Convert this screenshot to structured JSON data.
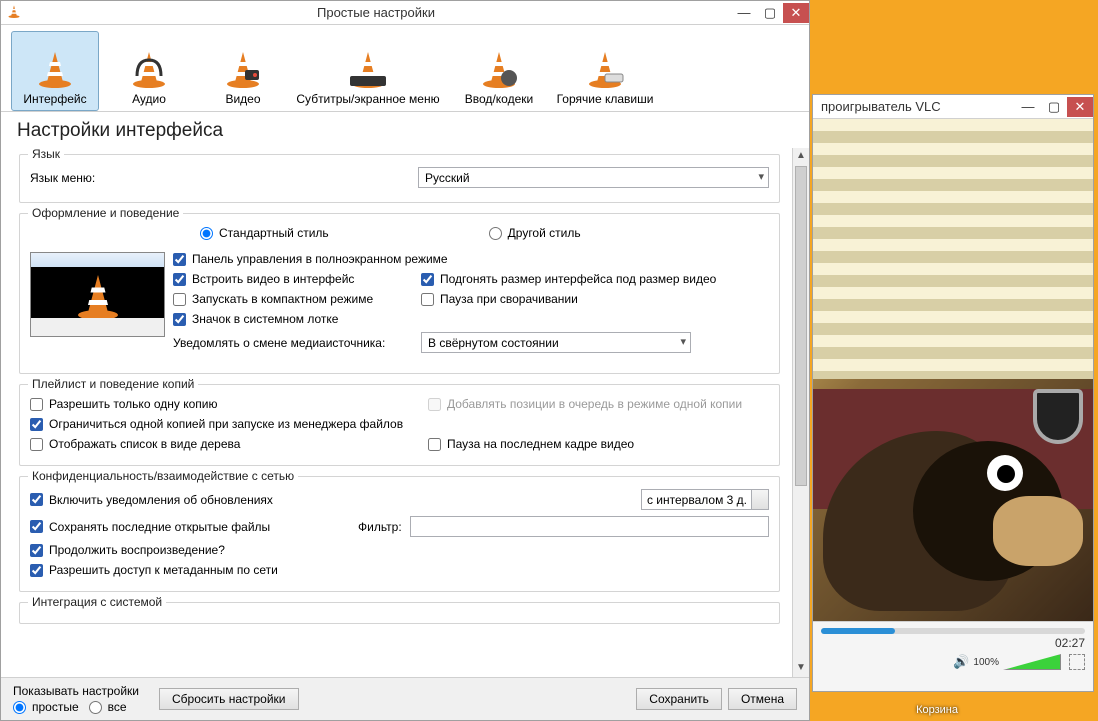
{
  "settings": {
    "window_title": "Простые настройки",
    "tabs": {
      "interface": "Интерфейс",
      "audio": "Аудио",
      "video": "Видео",
      "subtitles": "Субтитры/экранное меню",
      "input": "Ввод/кодеки",
      "hotkeys": "Горячие клавиши"
    },
    "section_title": "Настройки интерфейса",
    "language_group": "Язык",
    "menu_language_label": "Язык меню:",
    "menu_language_value": "Русский",
    "style_group": "Оформление и поведение",
    "style_standard": "Стандартный стиль",
    "style_other": "Другой стиль",
    "fullscreen_controller": "Панель управления в полноэкранном режиме",
    "embed_video": "Встроить видео в интерфейс",
    "resize_interface": "Подгонять размер интерфейса под размер видео",
    "start_minimal": "Запускать в компактном режиме",
    "pause_minimize": "Пауза при сворачивании",
    "systray_icon": "Значок в системном лотке",
    "notify_media_change_label": "Уведомлять о смене медиаисточника:",
    "notify_media_change_value": "В свёрнутом состоянии",
    "playlist_group": "Плейлист и поведение копий",
    "allow_one_instance": "Разрешить только одну копию",
    "enqueue_one_instance": "Добавлять позиции в очередь в режиме одной копии",
    "one_instance_from_fm": "Ограничиться одной копией при запуске из менеджера файлов",
    "display_tree": "Отображать список в виде дерева",
    "pause_last_frame": "Пауза на последнем кадре видео",
    "privacy_group": "Конфиденциальность/взаимодействие с сетью",
    "enable_update_notify": "Включить уведомления об обновлениях",
    "update_interval": "с интервалом 3 д.",
    "save_recent": "Сохранять последние открытые файлы",
    "filter_label": "Фильтр:",
    "continue_playback": "Продолжить воспроизведение?",
    "allow_metadata_net": "Разрешить доступ к метаданным по сети",
    "os_integration_group": "Интеграция с системой",
    "show_settings_label": "Показывать настройки",
    "radio_simple": "простые",
    "radio_all": "все",
    "reset_btn": "Сбросить настройки",
    "save_btn": "Сохранить",
    "cancel_btn": "Отмена"
  },
  "player": {
    "window_title": "проигрыватель VLC",
    "time": "02:27",
    "volume_pct": "100%"
  },
  "desktop": {
    "trash": "Корзина"
  }
}
